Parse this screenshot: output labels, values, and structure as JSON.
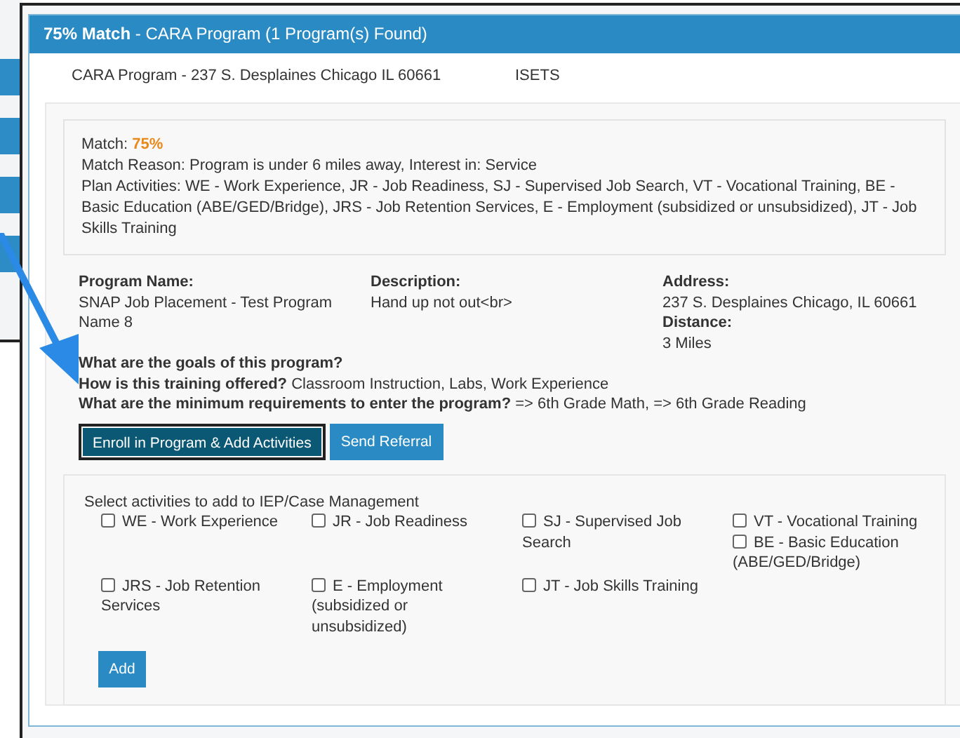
{
  "background": {
    "tabs": [
      {
        "selected": false
      },
      {
        "selected": false
      },
      {
        "selected": false
      },
      {
        "selected": false
      }
    ]
  },
  "modal": {
    "header": {
      "match": "75% Match",
      "title": " - CARA Program (1 Program(s) Found)"
    },
    "program_line": {
      "name": "CARA Program - 237 S. Desplaines Chicago IL 60661",
      "agency": "ISETS"
    },
    "match": {
      "label": "Match: ",
      "value": "75%"
    },
    "match_reason": "Match Reason: Program is under 6 miles away, Interest in: Service",
    "plan_activities": "Plan Activities: WE - Work Experience, JR - Job Readiness, SJ - Supervised Job Search, VT - Vocational Training, BE - Basic Education (ABE/GED/Bridge), JRS - Job Retention Services, E - Employment (subsidized or unsubsidized), JT - Job Skills Training",
    "details": [
      {
        "label": "Program Name:",
        "value": "SNAP Job Placement - Test Program Name 8"
      },
      {
        "label": "Description:",
        "value": "Hand up not out<br>"
      },
      {
        "label": "Address:",
        "value": "237 S. Desplaines Chicago, IL 60661",
        "extra_label": "Distance:",
        "extra_value": "3 Miles"
      }
    ],
    "questions": [
      "**What are the goals of this program?**",
      "**How is this training offered?** Classroom Instruction, Labs, Work Experience",
      "**What are the minimum requirements to enter the program?** => 6th Grade Math, => 6th Grade Reading"
    ],
    "buttons": [
      {
        "label": "Enroll in Program & Add Activities",
        "kind": "dark"
      },
      {
        "label": "Send Referral",
        "kind": "primary"
      }
    ],
    "activities": {
      "title": "Select activities to add to IEP/Case Management",
      "rows": [
        [
          [
            {
              "label": "WE - Work Experience",
              "checked": false
            }
          ],
          [
            {
              "label": "JR - Job Readiness",
              "checked": false
            }
          ],
          [
            {
              "label": "SJ - Supervised Job Search",
              "checked": false
            }
          ],
          [
            {
              "label": "VT - Vocational Training",
              "checked": false
            },
            {
              "label": "BE - Basic Education (ABE/GED/Bridge)",
              "checked": false
            }
          ]
        ],
        [
          [
            {
              "label": "JRS - Job Retention Services",
              "checked": false
            }
          ],
          [
            {
              "label": "E - Employment (subsidized or unsubsidized)",
              "checked": false
            }
          ],
          [
            {
              "label": "JT - Job Skills Training",
              "checked": false
            }
          ]
        ]
      ],
      "add_button": "Add"
    }
  }
}
